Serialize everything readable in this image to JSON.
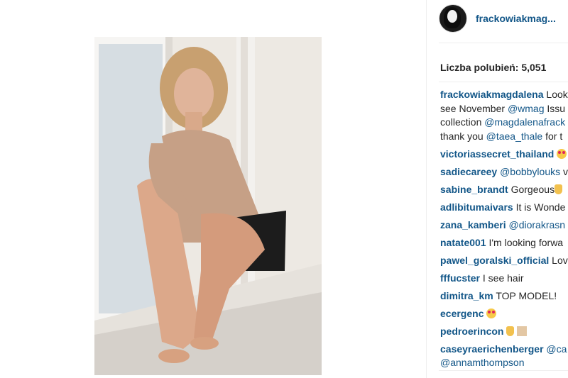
{
  "post": {
    "username_short": "frackowiakmag...",
    "likes_label": "Liczba polubień: 5,051",
    "image": {
      "description_icon": "photo-icon",
      "colors": {
        "wall": "#ece8e2",
        "sweater": "#c49a7e",
        "skin": "#d9a98a",
        "hair": "#c9a473",
        "window": "#cfd8de",
        "sill": "#e4e0da"
      }
    }
  },
  "caption": {
    "author": "frackowiakmagdalena",
    "line1_text": " Look",
    "line2_text": "see November ",
    "line2_mention": "@wmag",
    "line2_tail": " Issu",
    "line3_text": "collection ",
    "line3_mention": "@magdalenafrack",
    "line4_text": "thank you ",
    "line4_mention": "@taea_thale",
    "line4_tail": " for t"
  },
  "comments": [
    {
      "author": "victoriassecret_thailand",
      "text": " ",
      "emoji": "heart-eyes-emoji"
    },
    {
      "author": "sadiecareey",
      "mention": " @bobbylouks",
      "text": " v"
    },
    {
      "author": "sabine_brandt",
      "text": " Gorgeous",
      "emoji": "hand-emoji"
    },
    {
      "author": "adlibitumaivars",
      "text": " It is Wonde"
    },
    {
      "author": "zana_kamberi",
      "mention": " @diorakrasn",
      "text": ""
    },
    {
      "author": "natate001",
      "text": " I'm looking forwa"
    },
    {
      "author": "pawel_goralski_official",
      "text": " Lov"
    },
    {
      "author": "fffucster",
      "text": " I see hair"
    },
    {
      "author": "dimitra_km",
      "text": " TOP MODEL!"
    },
    {
      "author": "ecergenc",
      "text": " ",
      "emoji": "heart-eyes-emoji"
    },
    {
      "author": "pedroerincon",
      "text": " ",
      "emoji": "ok-hand-emoji"
    },
    {
      "author": "caseyraerichenberger",
      "mention": " @ca",
      "text": "",
      "line2_mention": "@annamthompson"
    }
  ],
  "colors": {
    "link": "#125688",
    "text": "#262626",
    "divider": "#efefef"
  }
}
